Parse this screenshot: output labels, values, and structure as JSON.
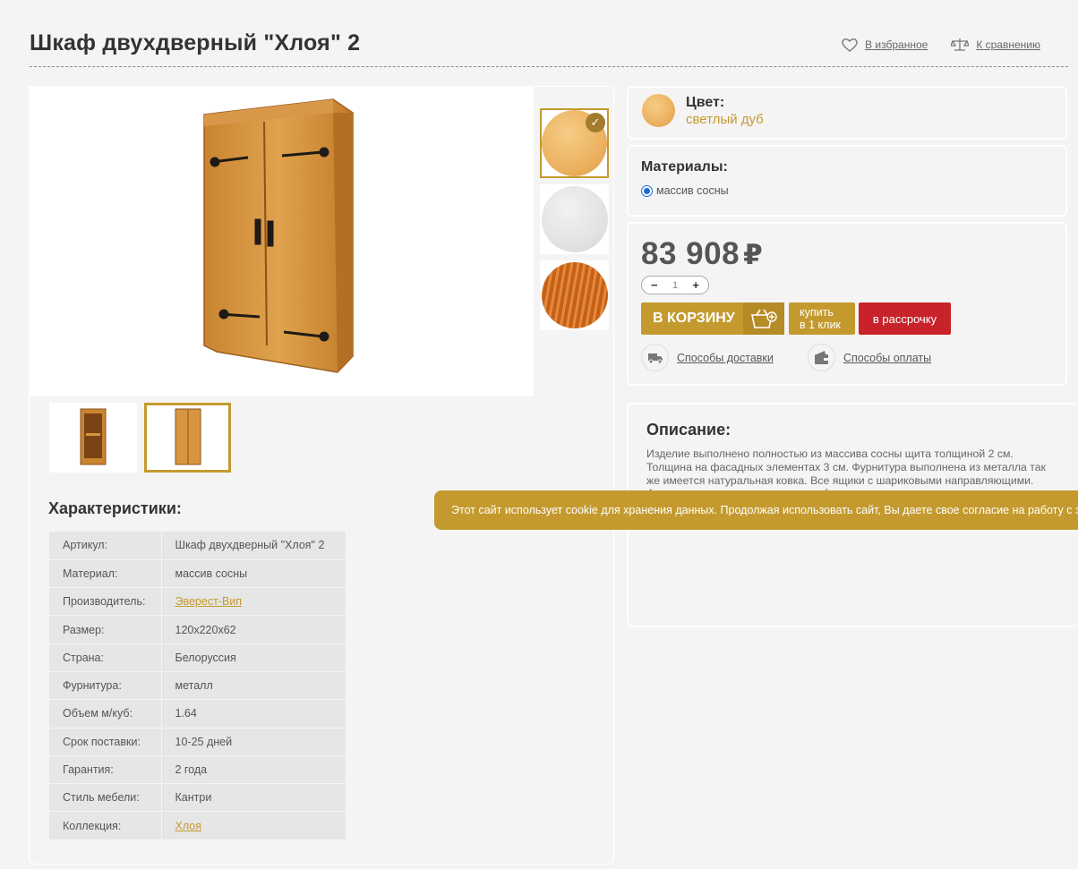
{
  "header": {
    "title": "Шкаф двухдверный \"Хлоя\" 2",
    "favorites_label": "В избранное",
    "compare_label": "К сравнению"
  },
  "gallery": {
    "swatches": [
      {
        "name": "светлый дуб",
        "color": "#e9ad5a",
        "selected": true
      },
      {
        "name": "white",
        "color": "#e4e4e4",
        "selected": false
      },
      {
        "name": "dark",
        "color": "#c95f16",
        "selected": false
      }
    ]
  },
  "specs": {
    "title": "Характеристики:",
    "rows": [
      {
        "key": "Артикул:",
        "value": "Шкаф двухдверный \"Хлоя\" 2",
        "link": false
      },
      {
        "key": "Материал:",
        "value": "массив сосны",
        "link": false
      },
      {
        "key": "Производитель:",
        "value": "Эверест-Вип",
        "link": true
      },
      {
        "key": "Размер:",
        "value": "120х220х62",
        "link": false
      },
      {
        "key": "Страна:",
        "value": "Белоруссия",
        "link": false
      },
      {
        "key": "Фурнитура:",
        "value": "металл",
        "link": false
      },
      {
        "key": "Объем м/куб:",
        "value": "1.64",
        "link": false
      },
      {
        "key": "Срок поставки:",
        "value": "10-25 дней",
        "link": false
      },
      {
        "key": "Гарантия:",
        "value": "2 года",
        "link": false
      },
      {
        "key": "Стиль мебели:",
        "value": "Кантри",
        "link": false
      },
      {
        "key": "Коллекция:",
        "value": "Хлоя",
        "link": true
      }
    ]
  },
  "color": {
    "heading": "Цвет:",
    "value": "светлый дуб"
  },
  "materials": {
    "heading": "Материалы:",
    "option": "массив сосны"
  },
  "buy": {
    "price": "83 908",
    "currency": "₽",
    "qty": "1",
    "minus": "−",
    "plus": "+",
    "cart_label": "В КОРЗИНУ",
    "one_click_line1": "купить",
    "one_click_line2": "в 1 клик",
    "credit_label": "в рассрочку",
    "delivery_label": "Способы доставки",
    "payment_label": "Способы оплаты"
  },
  "description": {
    "heading": "Описание:",
    "text": "Изделие выполнено полностью из массива сосны щита толщиной 2 см. Толщина на фасадных элементах 3 см. Фурнитура выполнена из металла так же имеется натуральная ковка. Все ящики с шариковыми направляющими. Фасады типа жалюзи не сквозные (не пропускает"
  },
  "cookie": {
    "text": "Этот сайт использует cookie для хранения данных. Продолжая использовать сайт, Вы даете свое согласие на работу с этими файлами."
  },
  "colors": {
    "accent": "#c49a2f",
    "credit": "#c8232b"
  }
}
